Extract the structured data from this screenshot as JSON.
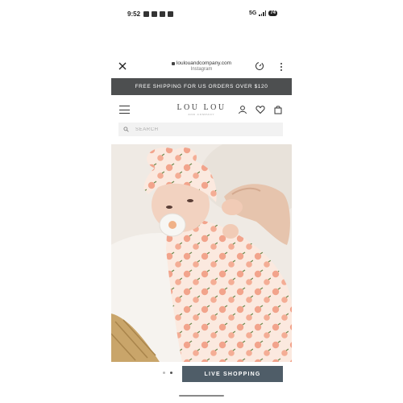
{
  "status_bar": {
    "time": "9:52",
    "network": "5G",
    "battery": "74"
  },
  "browser": {
    "url": "loulouandcompany.com",
    "subtitle": "Instagram"
  },
  "banner": {
    "text": "FREE SHIPPING FOR US ORDERS OVER $120"
  },
  "header": {
    "logo": "LOU LOU",
    "logo_tagline": "AND COMPANY"
  },
  "search": {
    "placeholder": "SEARCH"
  },
  "carousel": {
    "dot_count": 2,
    "active_index": 1
  },
  "cta": {
    "label": "LIVE SHOPPING"
  }
}
